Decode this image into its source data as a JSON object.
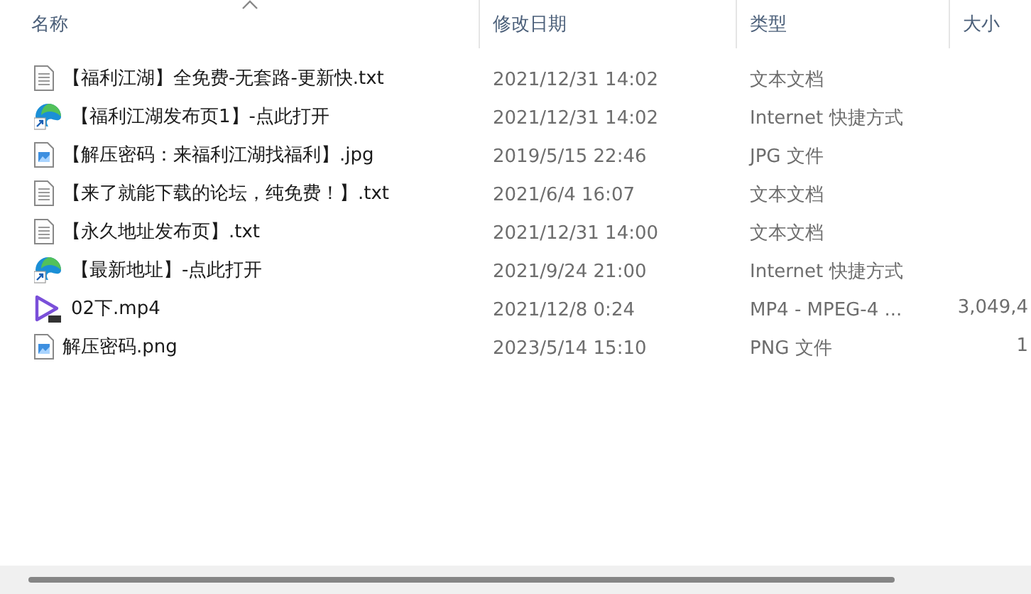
{
  "columns": [
    {
      "label": "名称",
      "sorted": true
    },
    {
      "label": "修改日期",
      "sorted": false
    },
    {
      "label": "类型",
      "sorted": false
    },
    {
      "label": "大小",
      "sorted": false
    }
  ],
  "files": [
    {
      "kind": "text",
      "name": "【福利江湖】全免费-无套路-更新快.txt",
      "date": "2021/12/31 14:02",
      "type": "文本文档"
    },
    {
      "kind": "shortcut",
      "name": "【福利江湖发布页1】-点此打开",
      "date": "2021/12/31 14:02",
      "type": "Internet 快捷方式"
    },
    {
      "kind": "image",
      "name": "【解压密码：来福利江湖找福利】.jpg",
      "date": "2019/5/15 22:46",
      "type": "JPG 文件"
    },
    {
      "kind": "text",
      "name": "【来了就能下载的论坛，纯免费！】.txt",
      "date": "2021/6/4 16:07",
      "type": "文本文档"
    },
    {
      "kind": "text",
      "name": "【永久地址发布页】.txt",
      "date": "2021/12/31 14:00",
      "type": "文本文档"
    },
    {
      "kind": "shortcut",
      "name": "【最新地址】-点此打开",
      "date": "2021/9/24 21:00",
      "type": "Internet 快捷方式"
    },
    {
      "kind": "video",
      "name": "02下.mp4",
      "date": "2021/12/8 0:24",
      "type": "MP4 - MPEG-4 ...",
      "size": "3,049,4"
    },
    {
      "kind": "image",
      "name": "解压密码.png",
      "date": "2023/5/14 15:10",
      "type": "PNG 文件",
      "size": "1"
    }
  ]
}
